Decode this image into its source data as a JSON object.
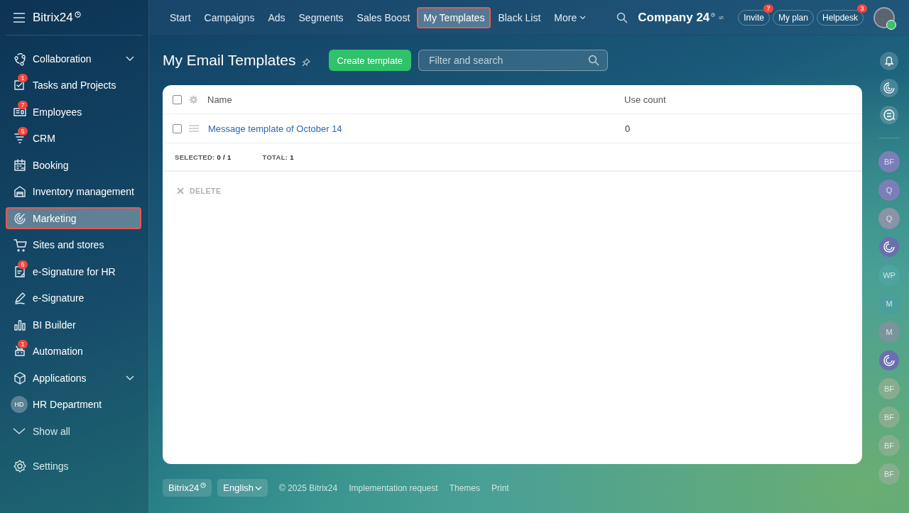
{
  "logo": {
    "name": "Bitrix24"
  },
  "sidebar": {
    "items": [
      {
        "label": "Collaboration",
        "kind": "group",
        "selected": false
      },
      {
        "label": "Tasks and Projects",
        "kind": "item",
        "badge": "1",
        "selected": false
      },
      {
        "label": "Employees",
        "kind": "item",
        "badge": "7",
        "selected": false
      },
      {
        "label": "CRM",
        "kind": "item",
        "badge": "5",
        "selected": false
      },
      {
        "label": "Booking",
        "kind": "item",
        "selected": false
      },
      {
        "label": "Inventory management",
        "kind": "item",
        "selected": false
      },
      {
        "label": "Marketing",
        "kind": "item",
        "selected": true
      },
      {
        "label": "Sites and stores",
        "kind": "item",
        "selected": false
      },
      {
        "label": "e-Signature for HR",
        "kind": "item",
        "badge": "6",
        "selected": false
      },
      {
        "label": "e-Signature",
        "kind": "item",
        "selected": false
      },
      {
        "label": "BI Builder",
        "kind": "item",
        "selected": false
      },
      {
        "label": "Automation",
        "kind": "item",
        "badge": "1",
        "selected": false
      },
      {
        "label": "Applications",
        "kind": "group",
        "selected": false
      },
      {
        "label": "HR Department",
        "kind": "avatar",
        "initials": "HD",
        "selected": false
      }
    ],
    "show_all": "Show all",
    "settings": "Settings"
  },
  "top_nav": {
    "tabs": [
      {
        "label": "Start",
        "selected": false
      },
      {
        "label": "Campaigns",
        "selected": false
      },
      {
        "label": "Ads",
        "selected": false
      },
      {
        "label": "Segments",
        "selected": false
      },
      {
        "label": "Sales Boost",
        "selected": false
      },
      {
        "label": "My Templates",
        "selected": true
      },
      {
        "label": "Black List",
        "selected": false
      }
    ],
    "more": "More"
  },
  "company": "Company 24",
  "header_buttons": [
    {
      "label": "Invite",
      "badge": "7"
    },
    {
      "label": "My plan"
    },
    {
      "label": "Helpdesk",
      "badge": "3"
    }
  ],
  "page": {
    "title": "My Email Templates",
    "create_button": "Create template",
    "search": {
      "placeholder": "Filter and search"
    }
  },
  "table": {
    "header_checked": false,
    "columns": [
      "Name",
      "Use count"
    ],
    "rows": [
      {
        "name": "Message template of October 14",
        "use_count": "0",
        "checked": false
      }
    ],
    "selected_label": "SELECTED:",
    "selected_value": "0 / 1",
    "total_label": "TOTAL:",
    "total_value": "1",
    "delete": "DELETE"
  },
  "right_rail": {
    "items": [
      {
        "kind": "initials",
        "initials": "BF",
        "color": "#7b7fb8"
      },
      {
        "kind": "initials",
        "initials": "Q",
        "color": "#7b7fb8"
      },
      {
        "kind": "initials",
        "initials": "Q",
        "color": "#8a93a8"
      },
      {
        "kind": "logo",
        "color": "#6a6fae"
      },
      {
        "kind": "initials",
        "initials": "WP",
        "color": "#4fa3a0"
      },
      {
        "kind": "initials",
        "initials": "M",
        "color": "#4a9e9e"
      },
      {
        "kind": "initials",
        "initials": "M",
        "color": "#7a949b"
      },
      {
        "kind": "logo",
        "color": "#6a6fae"
      },
      {
        "kind": "initials",
        "initials": "BF",
        "color": "#86ae8e"
      },
      {
        "kind": "initials",
        "initials": "BF",
        "color": "#86ae8e"
      },
      {
        "kind": "initials",
        "initials": "BF",
        "color": "#86ae8e"
      },
      {
        "kind": "initials",
        "initials": "BF",
        "color": "#86ae8e"
      }
    ]
  },
  "footer": {
    "logo": "Bitrix24",
    "language": "English",
    "links": [
      "© 2025 Bitrix24",
      "Implementation request",
      "Themes",
      "Print"
    ]
  }
}
